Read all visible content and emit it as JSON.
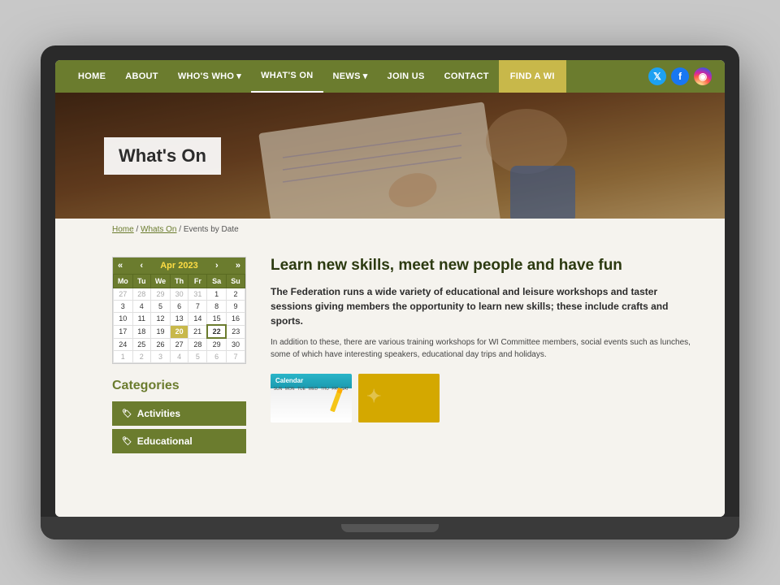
{
  "nav": {
    "items": [
      {
        "label": "HOME",
        "active": false
      },
      {
        "label": "ABOUT",
        "active": false
      },
      {
        "label": "WHO'S WHO",
        "active": false,
        "dropdown": true
      },
      {
        "label": "WHAT'S ON",
        "active": true
      },
      {
        "label": "NEWS",
        "active": false,
        "dropdown": true
      },
      {
        "label": "JOIN US",
        "active": false
      },
      {
        "label": "CONTACT",
        "active": false
      },
      {
        "label": "FIND A WI",
        "active": false,
        "special": true
      }
    ],
    "social": [
      {
        "name": "twitter",
        "symbol": "𝕏"
      },
      {
        "name": "facebook",
        "symbol": "f"
      },
      {
        "name": "instagram",
        "symbol": "📷"
      }
    ]
  },
  "hero": {
    "title": "What's On"
  },
  "breadcrumb": {
    "home": "Home",
    "whats_on": "Whats On",
    "current": "Events by Date"
  },
  "calendar": {
    "month": "Apr 2023",
    "prev_prev": "«",
    "prev": "‹",
    "next": "›",
    "next_next": "»",
    "days_header": [
      "Mo",
      "Tu",
      "We",
      "Th",
      "Fr",
      "Sa",
      "Su"
    ],
    "weeks": [
      [
        "27",
        "28",
        "29",
        "30",
        "31",
        "1",
        "2"
      ],
      [
        "3",
        "4",
        "5",
        "6",
        "7",
        "8",
        "9"
      ],
      [
        "10",
        "11",
        "12",
        "13",
        "14",
        "15",
        "16"
      ],
      [
        "17",
        "18",
        "19",
        "20",
        "21",
        "22",
        "23"
      ],
      [
        "24",
        "25",
        "26",
        "27",
        "28",
        "29",
        "30"
      ],
      [
        "1",
        "2",
        "3",
        "4",
        "5",
        "6",
        "7"
      ]
    ],
    "today_cell": "22",
    "selected_cell": "20"
  },
  "categories": {
    "title": "Categories",
    "items": [
      {
        "label": "Activities"
      },
      {
        "label": "Educational"
      }
    ]
  },
  "content": {
    "heading": "Learn new skills, meet new people and have fun",
    "intro_bold": "The Federation runs a wide variety of educational and leisure workshops and taster sessions giving members the opportunity to learn new skills; these include crafts and sports.",
    "intro_normal": "In addition to these, there are various training workshops for WI Committee members, social events such as lunches, some of which have interesting speakers, educational day trips and holidays."
  },
  "colors": {
    "primary_green": "#6b7c2e",
    "gold": "#c8b84a",
    "text_dark": "#2c3a10"
  }
}
